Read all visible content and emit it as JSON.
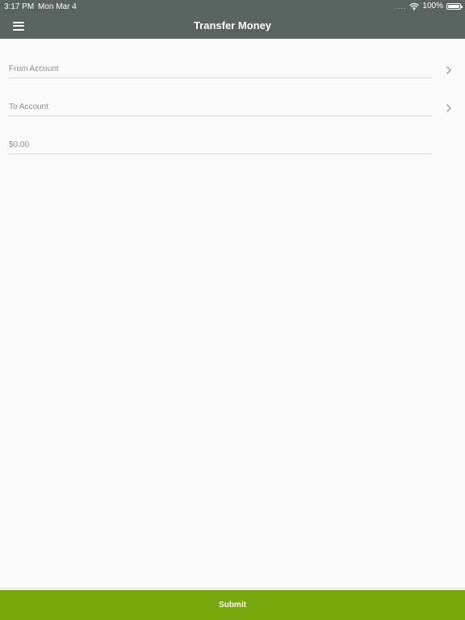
{
  "status_bar": {
    "time": "3:17 PM",
    "date": "Mon Mar 4",
    "signal": "....",
    "battery": "100%"
  },
  "header": {
    "title": "Transfer Money",
    "menu_icon": "hamburger-menu-icon"
  },
  "form": {
    "from_account": {
      "label": "From Account",
      "icon": "chevron-right-icon"
    },
    "to_account": {
      "label": "To Account",
      "icon": "chevron-right-icon"
    },
    "amount": {
      "placeholder": "$0.00",
      "value": ""
    }
  },
  "footer": {
    "submit_label": "Submit"
  },
  "colors": {
    "header_background": "#5b6361",
    "submit_background": "#76a80b",
    "page_background": "#fafafa"
  }
}
